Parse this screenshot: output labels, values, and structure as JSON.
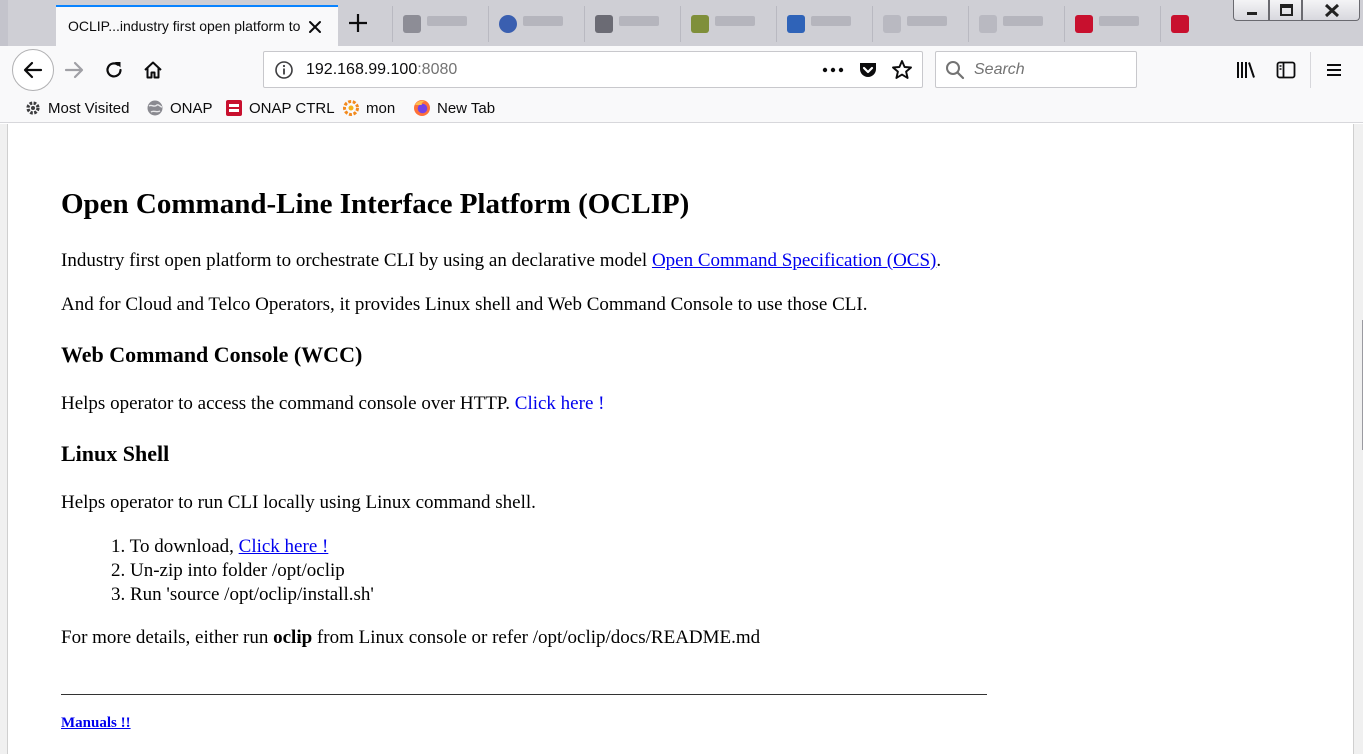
{
  "browser": {
    "active_tab_title": "OCLIP...industry first open platform to",
    "url_host": "192.168.99.100",
    "url_port": ":8080",
    "search_placeholder": "Search",
    "colors": {
      "tab_accent": "#0a84ff",
      "link": "#0000ee",
      "toolbar_bg": "#f9f9fa",
      "titlebar_bg": "#cfcfd5"
    },
    "icons": [
      "back-arrow-icon",
      "forward-arrow-icon",
      "reload-icon",
      "home-icon",
      "info-icon",
      "more-dots-icon",
      "pocket-icon",
      "star-icon",
      "search-icon",
      "library-icon",
      "sidebar-icon",
      "menu-icon",
      "close-icon",
      "plus-icon"
    ]
  },
  "bookmarks": [
    {
      "label": "Most Visited",
      "icon": "gear-icon"
    },
    {
      "label": "ONAP",
      "icon": "globe-icon"
    },
    {
      "label": "ONAP CTRL",
      "icon": "onap-ctrl-icon"
    },
    {
      "label": "mon",
      "icon": "grafana-icon"
    },
    {
      "label": "New Tab",
      "icon": "firefox-icon"
    }
  ],
  "page": {
    "title": "Open Command-Line Interface Platform (OCLIP)",
    "intro_1_text": "Industry first open platform to orchestrate CLI by using an declarative model ",
    "intro_1_link": "Open Command Specification (OCS)",
    "intro_1_end": ".",
    "intro_2": "And for Cloud and Telco Operators, it provides Linux shell and Web Command Console to use those CLI.",
    "wcc_heading": "Web Command Console (WCC)",
    "wcc_text": "Helps operator to access the command console over HTTP. ",
    "wcc_link": "Click here !",
    "linux_heading": "Linux Shell",
    "linux_text": "Helps operator to run CLI locally using Linux command shell.",
    "steps": [
      {
        "num": "1.",
        "text": "To download, ",
        "link": "Click here !"
      },
      {
        "num": "2.",
        "text": "Un-zip into folder /opt/oclip"
      },
      {
        "num": "3.",
        "text": "Run 'source /opt/oclip/install.sh'"
      }
    ],
    "details_pre": "For more details, either run ",
    "details_bold": "oclip",
    "details_post": " from Linux console or refer /opt/oclip/docs/README.md",
    "manuals_link": "Manuals !!"
  }
}
